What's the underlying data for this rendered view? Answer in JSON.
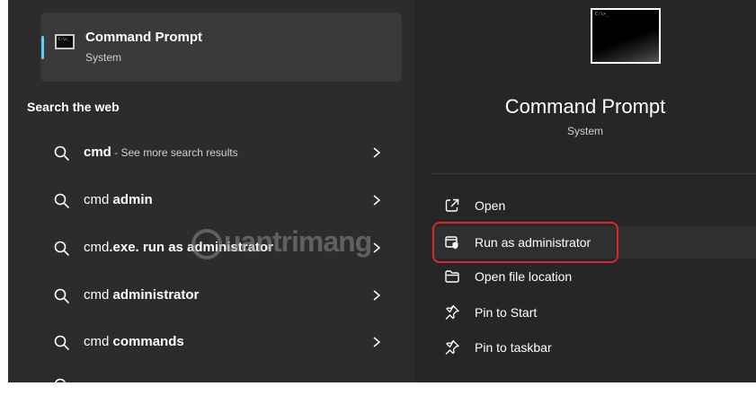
{
  "best_match": {
    "title": "Command Prompt",
    "subtitle": "System",
    "icon": "cmd-app-icon",
    "icon_text": "C:\\>_"
  },
  "search_web": {
    "heading": "Search the web",
    "results": [
      {
        "prefix": "",
        "bold": "cmd",
        "suffix": " - See more search results"
      },
      {
        "prefix": "cmd ",
        "bold": "admin",
        "suffix": ""
      },
      {
        "prefix": "cmd",
        "bold": ".exe. run as administrator",
        "suffix": ""
      },
      {
        "prefix": "cmd ",
        "bold": "administrator",
        "suffix": ""
      },
      {
        "prefix": "cmd ",
        "bold": "commands",
        "suffix": ""
      }
    ]
  },
  "watermark": {
    "text": "uantrimang"
  },
  "details": {
    "title": "Command Prompt",
    "subtitle": "System",
    "preview_text": "C:\\>_",
    "actions": [
      {
        "label": "Open",
        "icon": "open-icon"
      },
      {
        "label": "Run as administrator",
        "icon": "run-as-admin-icon"
      },
      {
        "label": "Open file location",
        "icon": "folder-icon"
      },
      {
        "label": "Pin to Start",
        "icon": "pin-icon"
      },
      {
        "label": "Pin to taskbar",
        "icon": "pin-icon"
      }
    ]
  },
  "colors": {
    "accent": "#60cdff",
    "highlight_box": "#e0242b",
    "left_bg": "#2c2c2c",
    "right_bg": "#262626"
  }
}
